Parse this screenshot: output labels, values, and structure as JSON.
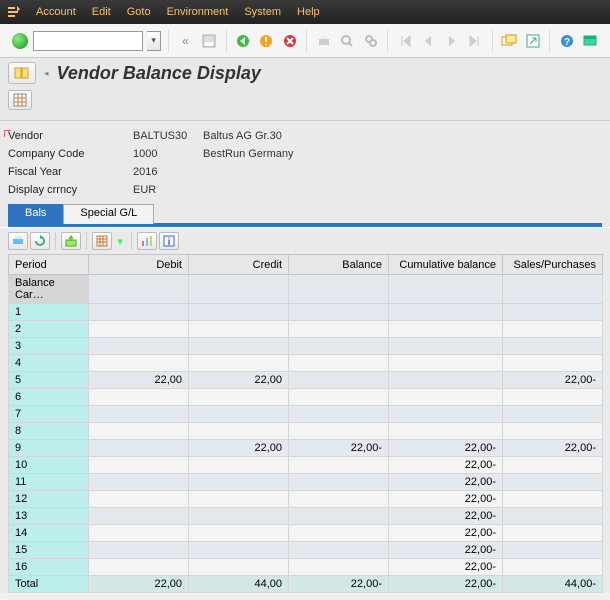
{
  "menu": {
    "items": [
      "Account",
      "Edit",
      "Goto",
      "Environment",
      "System",
      "Help"
    ]
  },
  "title": "Vendor Balance Display",
  "info": {
    "vendor_label": "Vendor",
    "vendor_code": "BALTUS30",
    "vendor_name": "Baltus AG Gr.30",
    "cocode_label": "Company Code",
    "cocode": "1000",
    "cocode_name": "BestRun Germany",
    "fy_label": "Fiscal Year",
    "fy": "2016",
    "crncy_label": "Display crrncy",
    "crncy": "EUR"
  },
  "tabs": {
    "active": "Bals",
    "other": "Special G/L"
  },
  "columns": [
    "Period",
    "Debit",
    "Credit",
    "Balance",
    "Cumulative balance",
    "Sales/Purchases"
  ],
  "rows": [
    {
      "period": "Balance Car…",
      "debit": "",
      "credit": "",
      "balance": "",
      "cum": "",
      "sp": ""
    },
    {
      "period": "1",
      "debit": "",
      "credit": "",
      "balance": "",
      "cum": "",
      "sp": ""
    },
    {
      "period": "2",
      "debit": "",
      "credit": "",
      "balance": "",
      "cum": "",
      "sp": ""
    },
    {
      "period": "3",
      "debit": "",
      "credit": "",
      "balance": "",
      "cum": "",
      "sp": ""
    },
    {
      "period": "4",
      "debit": "",
      "credit": "",
      "balance": "",
      "cum": "",
      "sp": ""
    },
    {
      "period": "5",
      "debit": "22,00",
      "credit": "22,00",
      "balance": "",
      "cum": "",
      "sp": "22,00-"
    },
    {
      "period": "6",
      "debit": "",
      "credit": "",
      "balance": "",
      "cum": "",
      "sp": ""
    },
    {
      "period": "7",
      "debit": "",
      "credit": "",
      "balance": "",
      "cum": "",
      "sp": ""
    },
    {
      "period": "8",
      "debit": "",
      "credit": "",
      "balance": "",
      "cum": "",
      "sp": ""
    },
    {
      "period": "9",
      "debit": "",
      "credit": "22,00",
      "balance": "22,00-",
      "cum": "22,00-",
      "sp": "22,00-"
    },
    {
      "period": "10",
      "debit": "",
      "credit": "",
      "balance": "",
      "cum": "22,00-",
      "sp": ""
    },
    {
      "period": "11",
      "debit": "",
      "credit": "",
      "balance": "",
      "cum": "22,00-",
      "sp": ""
    },
    {
      "period": "12",
      "debit": "",
      "credit": "",
      "balance": "",
      "cum": "22,00-",
      "sp": ""
    },
    {
      "period": "13",
      "debit": "",
      "credit": "",
      "balance": "",
      "cum": "22,00-",
      "sp": ""
    },
    {
      "period": "14",
      "debit": "",
      "credit": "",
      "balance": "",
      "cum": "22,00-",
      "sp": ""
    },
    {
      "period": "15",
      "debit": "",
      "credit": "",
      "balance": "",
      "cum": "22,00-",
      "sp": ""
    },
    {
      "period": "16",
      "debit": "",
      "credit": "",
      "balance": "",
      "cum": "22,00-",
      "sp": ""
    },
    {
      "period": "Total",
      "debit": "22,00",
      "credit": "44,00",
      "balance": "22,00-",
      "cum": "22,00-",
      "sp": "44,00-"
    }
  ]
}
